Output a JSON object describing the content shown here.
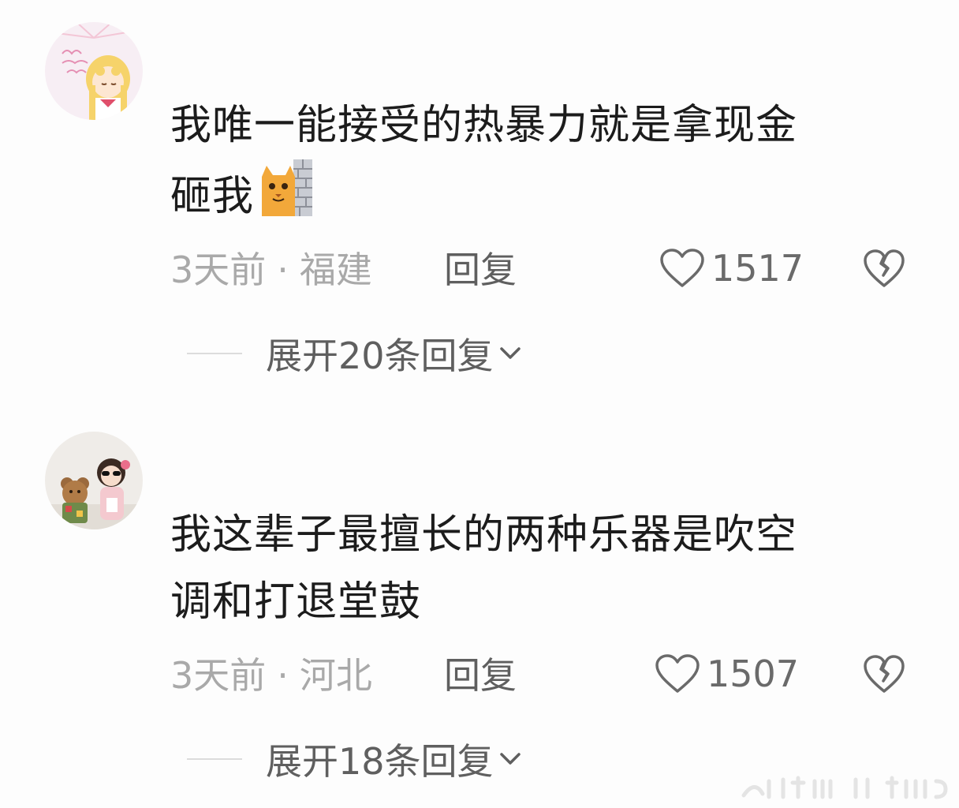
{
  "comments": [
    {
      "avatar": "sailor-moon-avatar",
      "text_line1": "我唯一能接受的热暴力就是拿现金",
      "text_line2": "砸我",
      "emoji": "cat-behind-wall-emoji",
      "time": "3天前",
      "location": "福建",
      "reply_label": "回复",
      "likes": "1517",
      "expand_label": "展开20条回复"
    },
    {
      "avatar": "girl-with-teddy-avatar",
      "text_line1": "我这辈子最擅长的两种乐器是吹空",
      "text_line2": "调和打退堂鼓",
      "time": "3天前",
      "location": "河北",
      "reply_label": "回复",
      "likes": "1507",
      "expand_label": "展开18条回复"
    }
  ],
  "separator": "·",
  "colors": {
    "text": "#1c1c1c",
    "meta": "#a9a9a9",
    "action": "#5f5f5f",
    "background": "#fdfdfd"
  }
}
